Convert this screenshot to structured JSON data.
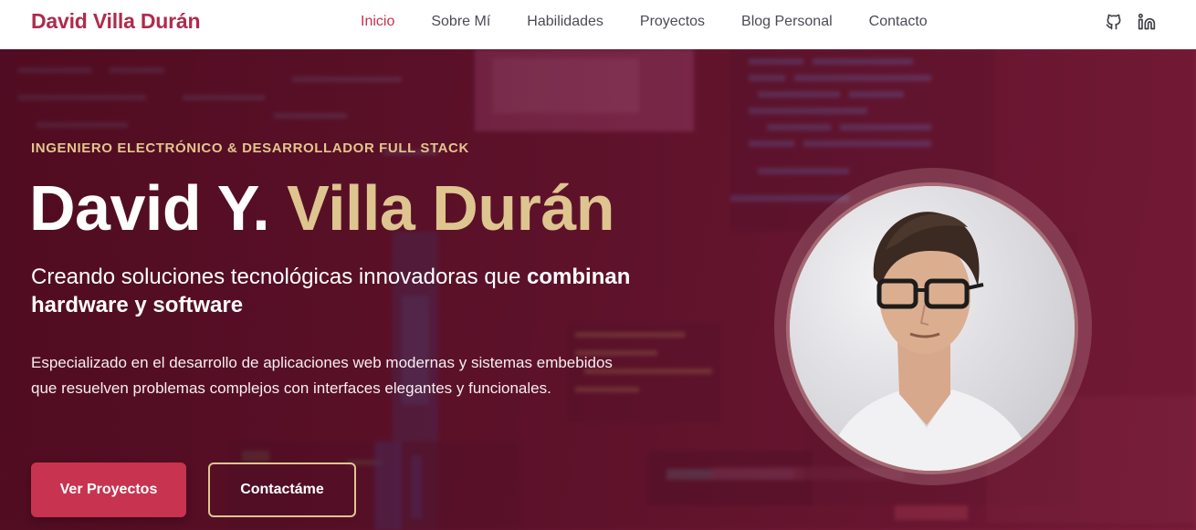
{
  "brand": "David Villa Durán",
  "nav": [
    {
      "label": "Inicio",
      "active": true
    },
    {
      "label": "Sobre Mí"
    },
    {
      "label": "Habilidades"
    },
    {
      "label": "Proyectos"
    },
    {
      "label": "Blog Personal"
    },
    {
      "label": "Contacto"
    }
  ],
  "socials": [
    {
      "icon": "github-icon"
    },
    {
      "icon": "linkedin-icon"
    }
  ],
  "hero": {
    "eyebrow": "INGENIERO ELECTRÓNICO & DESARROLLADOR FULL STACK",
    "title_first": "David Y.",
    "title_second": "Villa Durán",
    "subtitle_lead": "Creando soluciones tecnológicas innovadoras que ",
    "subtitle_bold": "combinan hardware y software",
    "description": "Especializado en el desarrollo de aplicaciones web modernas y sistemas embebidos que resuelven problemas complejos con interfaces elegantes y funcionales.",
    "primary_cta": "Ver Proyectos",
    "secondary_cta": "Contactáme"
  },
  "colors": {
    "brand": "#b02a4c",
    "accent": "#c9304f",
    "gold": "#dec58f",
    "hero_bg": "#6e1830"
  }
}
